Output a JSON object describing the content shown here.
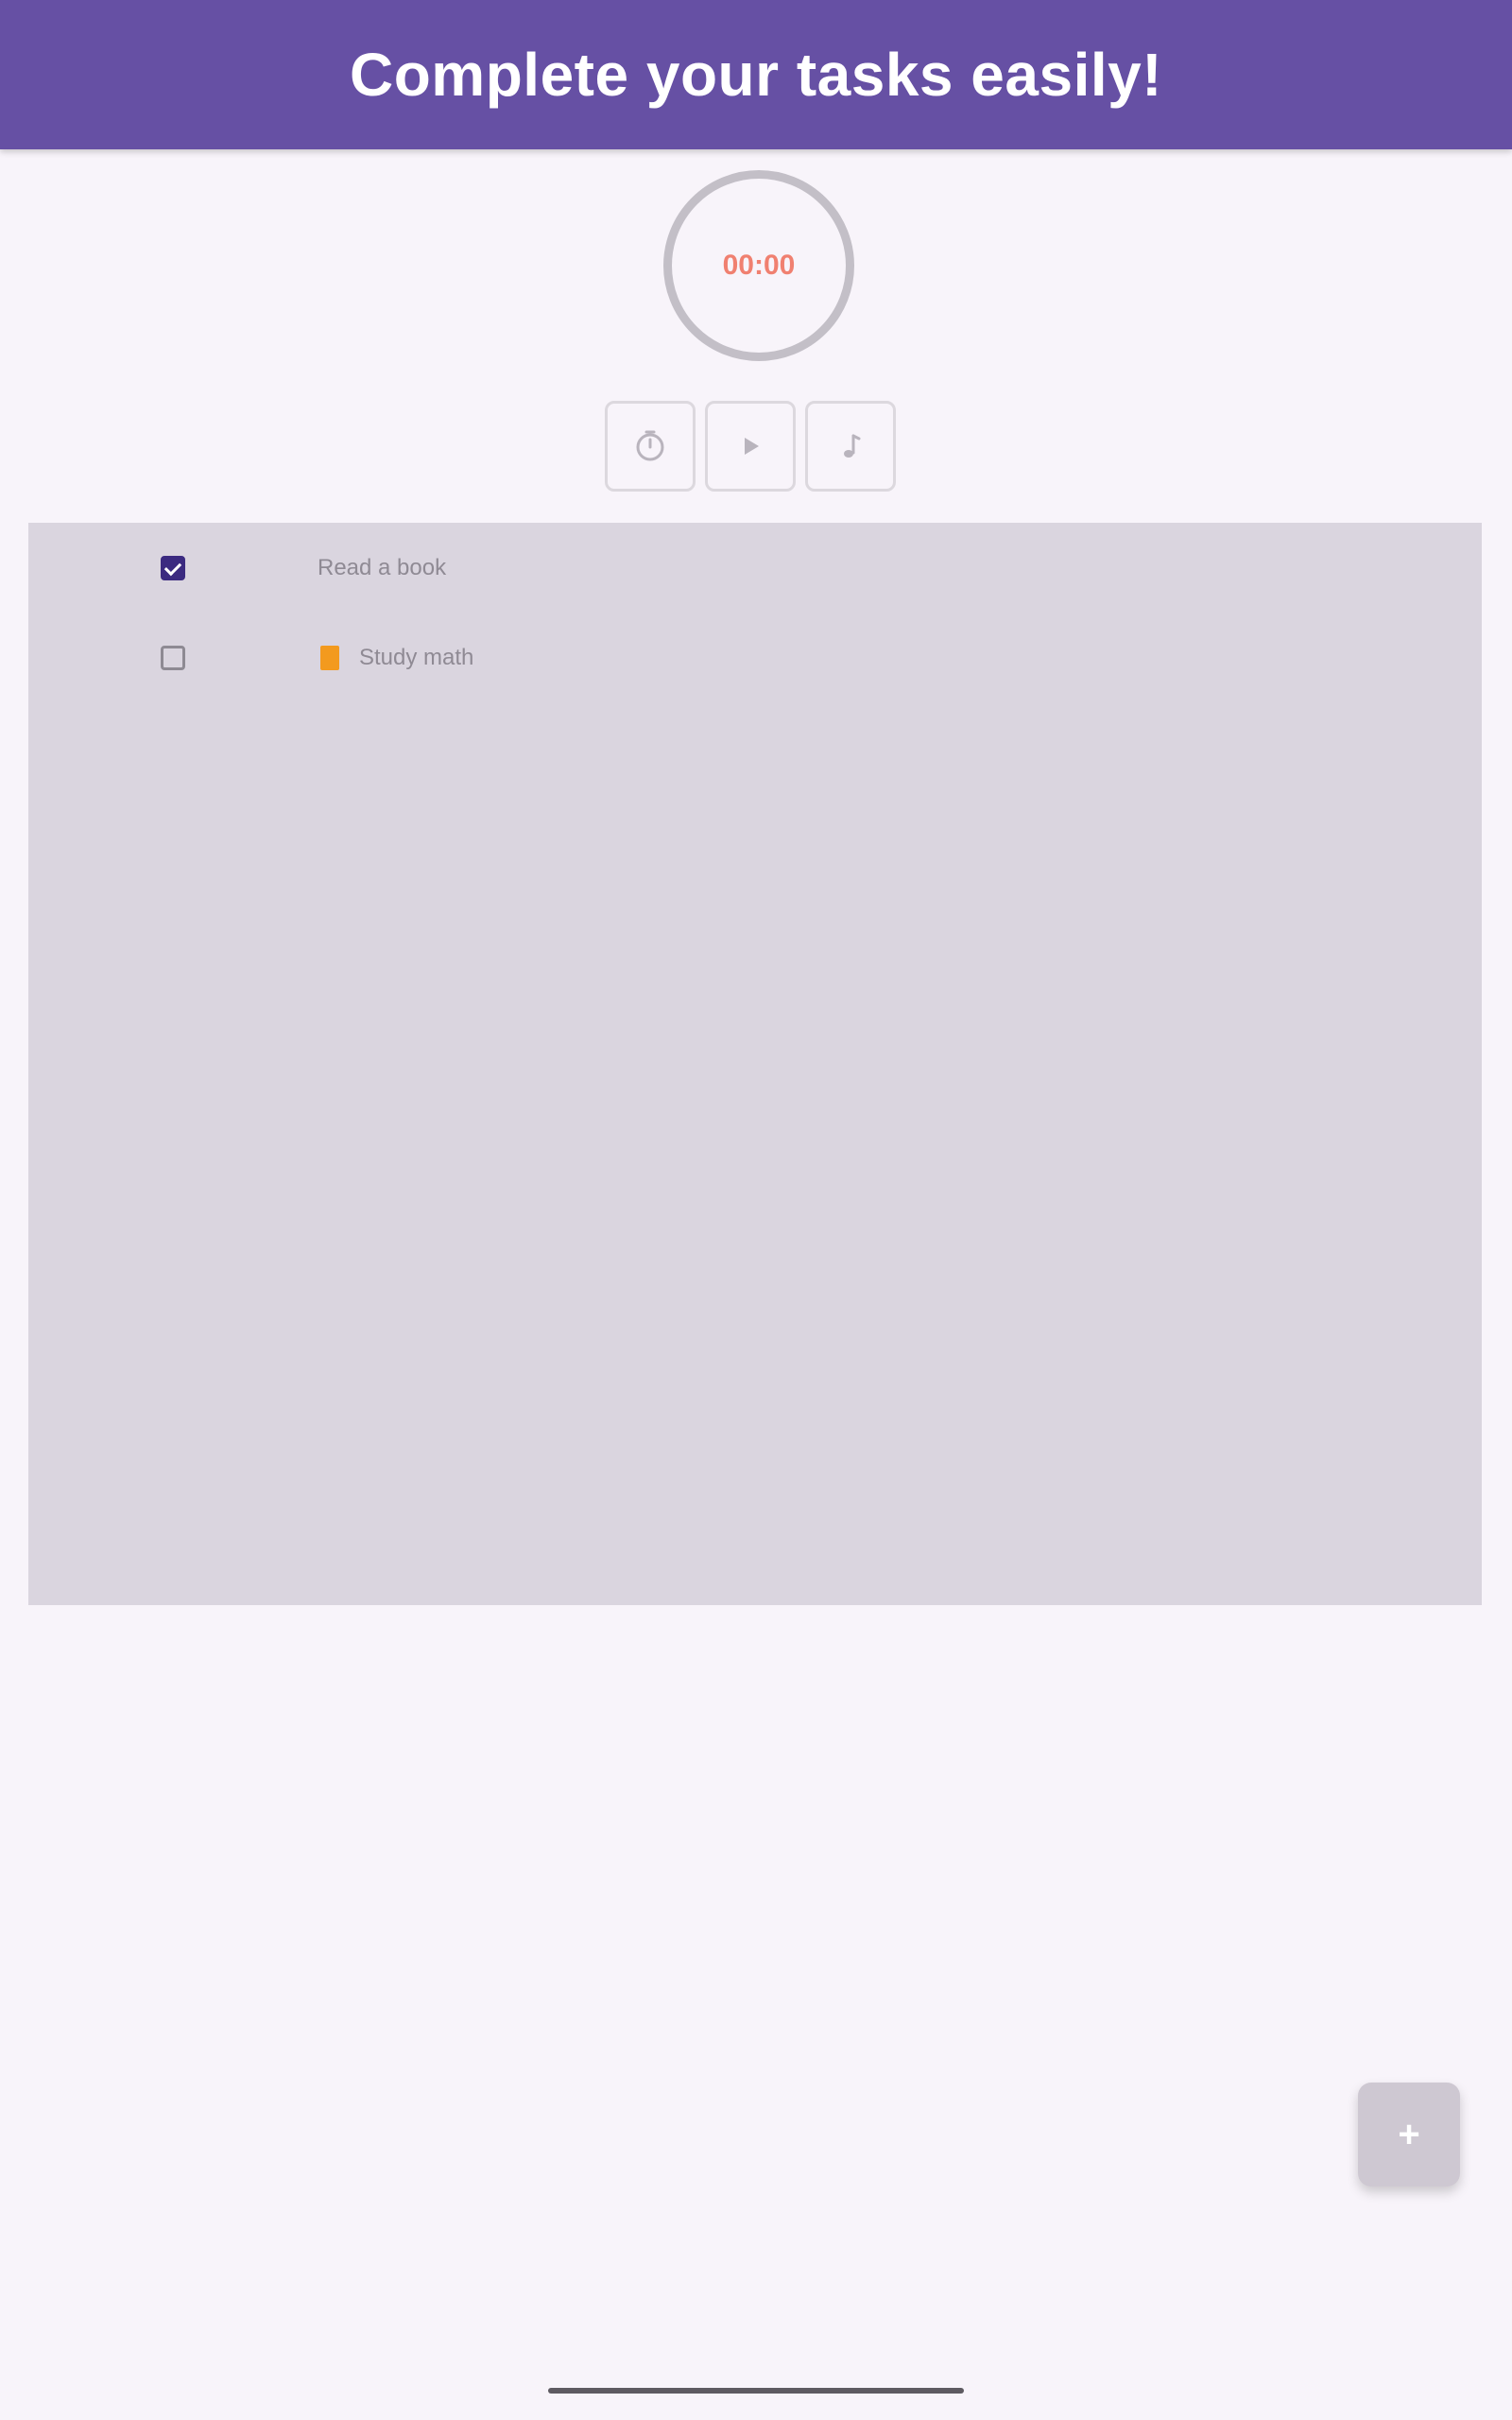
{
  "header": {
    "title": "Complete your tasks easily!"
  },
  "timer": {
    "display": "00:00"
  },
  "controls": [
    {
      "icon": "timer-icon"
    },
    {
      "icon": "play-icon"
    },
    {
      "icon": "music-icon"
    }
  ],
  "tasks": [
    {
      "label": "Read a book",
      "checked": true,
      "priority": null
    },
    {
      "label": "Study math",
      "checked": false,
      "priority": "orange"
    }
  ],
  "fab": {
    "icon": "plus-icon",
    "label": "+"
  },
  "colors": {
    "app_bar": "#6650a4",
    "background": "#f8f4fa",
    "panel": "#dad5df",
    "timer_text": "#f08070",
    "priority_orange": "#f39a1e",
    "checkbox_checked": "#3b2a80"
  }
}
